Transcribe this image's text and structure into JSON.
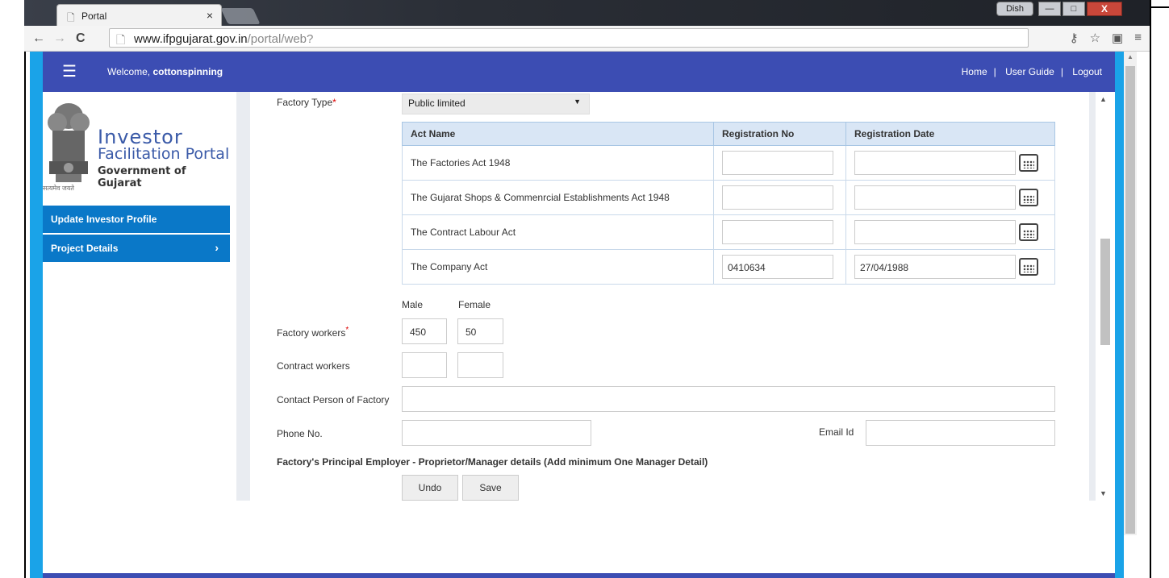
{
  "browser": {
    "tab_title": "Portal",
    "tab_close": "×",
    "url_domain": "www.ifpgujarat.gov.in",
    "url_path": "/portal/web?",
    "profile_label": "Dish",
    "minimize": "—",
    "maximize": "□",
    "close": "X"
  },
  "header": {
    "welcome_prefix": "Welcome,",
    "username": "cottonspinning",
    "links": [
      "Home",
      "User Guide",
      "Logout"
    ],
    "separator": "|"
  },
  "logo": {
    "line1": "Investor",
    "line2": "Facilitation Portal",
    "line3": "Government of Gujarat",
    "motto": "सत्यमेव जयते"
  },
  "sidebar": {
    "items": [
      {
        "label": "Update Investor Profile"
      },
      {
        "label": "Project Details",
        "chevron": "›"
      }
    ]
  },
  "form": {
    "factory_type_label": "Factory Type",
    "factory_type_value": "Public limited",
    "acts_table": {
      "headers": [
        "Act Name",
        "Registration No",
        "Registration Date"
      ],
      "rows": [
        {
          "act": "The Factories Act 1948",
          "reg_no": "",
          "reg_date": ""
        },
        {
          "act": "The Gujarat Shops & Commenrcial Establishments Act 1948",
          "reg_no": "",
          "reg_date": ""
        },
        {
          "act": "The Contract Labour Act",
          "reg_no": "",
          "reg_date": ""
        },
        {
          "act": "The Company Act",
          "reg_no": "0410634",
          "reg_date": "27/04/1988"
        }
      ]
    },
    "male_label": "Male",
    "female_label": "Female",
    "factory_workers_label": "Factory workers",
    "factory_workers_male": "450",
    "factory_workers_female": "50",
    "contract_workers_label": "Contract workers",
    "contract_workers_male": "",
    "contract_workers_female": "",
    "contact_person_label": "Contact Person of Factory",
    "contact_person_value": "",
    "phone_label": "Phone No.",
    "phone_value": "",
    "email_label": "Email Id",
    "email_value": "",
    "principal_employer_heading": "Factory's Principal Employer - Proprietor/Manager details (Add minimum One Manager Detail)",
    "undo_label": "Undo",
    "save_label": "Save",
    "required_mark": "*"
  },
  "colors": {
    "header_bg": "#3c4db3",
    "sidebar_item_bg": "#0a78c8",
    "page_side_bar": "#1aa3e8",
    "table_header_bg": "#d9e6f5"
  }
}
